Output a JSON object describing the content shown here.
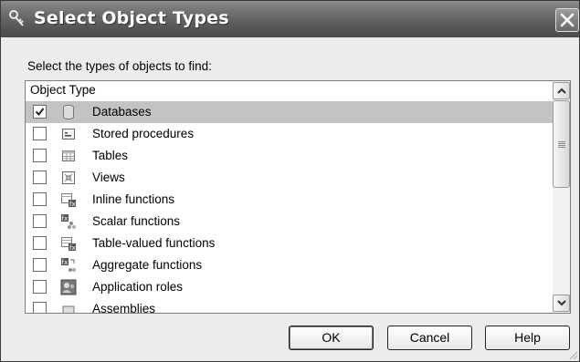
{
  "dialog": {
    "title": "Select Object Types",
    "prompt": "Select the types of objects to find:",
    "column_header": "Object Type",
    "items": [
      {
        "label": "Databases",
        "checked": true,
        "selected": true,
        "icon": "database-icon"
      },
      {
        "label": "Stored procedures",
        "checked": false,
        "selected": false,
        "icon": "stored-procedure-icon"
      },
      {
        "label": "Tables",
        "checked": false,
        "selected": false,
        "icon": "table-icon"
      },
      {
        "label": "Views",
        "checked": false,
        "selected": false,
        "icon": "view-icon"
      },
      {
        "label": "Inline functions",
        "checked": false,
        "selected": false,
        "icon": "inline-function-icon"
      },
      {
        "label": "Scalar functions",
        "checked": false,
        "selected": false,
        "icon": "scalar-function-icon"
      },
      {
        "label": "Table-valued functions",
        "checked": false,
        "selected": false,
        "icon": "table-valued-function-icon"
      },
      {
        "label": "Aggregate functions",
        "checked": false,
        "selected": false,
        "icon": "aggregate-function-icon"
      },
      {
        "label": "Application roles",
        "checked": false,
        "selected": false,
        "icon": "application-role-icon"
      },
      {
        "label": "Assemblies",
        "checked": false,
        "selected": false,
        "icon": "assembly-icon"
      }
    ],
    "buttons": {
      "ok": "OK",
      "cancel": "Cancel",
      "help": "Help"
    }
  },
  "colors": {
    "titlebar": "#5a5a5a",
    "selection": "#c3c3c3",
    "dialog_bg": "#ececec"
  }
}
